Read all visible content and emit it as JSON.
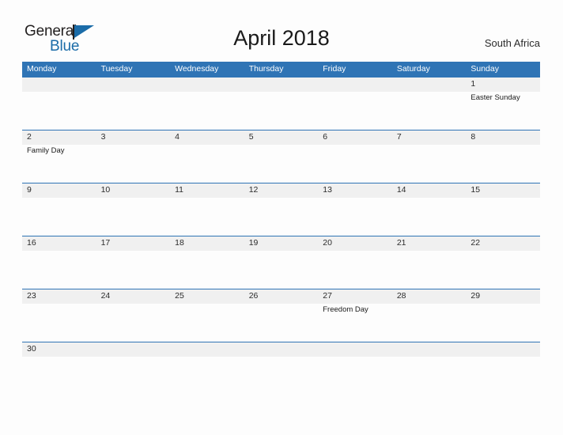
{
  "brand": {
    "word_one": "General",
    "word_two": "Blue",
    "accent_color": "#1b6ca8"
  },
  "header": {
    "title": "April 2018",
    "country": "South Africa",
    "header_bg": "#2F74B5",
    "band_bg": "#F0F0F0"
  },
  "weekday_headers": [
    "Monday",
    "Tuesday",
    "Wednesday",
    "Thursday",
    "Friday",
    "Saturday",
    "Sunday"
  ],
  "weeks": [
    {
      "days": [
        {
          "num": "",
          "event": ""
        },
        {
          "num": "",
          "event": ""
        },
        {
          "num": "",
          "event": ""
        },
        {
          "num": "",
          "event": ""
        },
        {
          "num": "",
          "event": ""
        },
        {
          "num": "",
          "event": ""
        },
        {
          "num": "1",
          "event": "Easter Sunday"
        }
      ]
    },
    {
      "days": [
        {
          "num": "2",
          "event": "Family Day"
        },
        {
          "num": "3",
          "event": ""
        },
        {
          "num": "4",
          "event": ""
        },
        {
          "num": "5",
          "event": ""
        },
        {
          "num": "6",
          "event": ""
        },
        {
          "num": "7",
          "event": ""
        },
        {
          "num": "8",
          "event": ""
        }
      ]
    },
    {
      "days": [
        {
          "num": "9",
          "event": ""
        },
        {
          "num": "10",
          "event": ""
        },
        {
          "num": "11",
          "event": ""
        },
        {
          "num": "12",
          "event": ""
        },
        {
          "num": "13",
          "event": ""
        },
        {
          "num": "14",
          "event": ""
        },
        {
          "num": "15",
          "event": ""
        }
      ]
    },
    {
      "days": [
        {
          "num": "16",
          "event": ""
        },
        {
          "num": "17",
          "event": ""
        },
        {
          "num": "18",
          "event": ""
        },
        {
          "num": "19",
          "event": ""
        },
        {
          "num": "20",
          "event": ""
        },
        {
          "num": "21",
          "event": ""
        },
        {
          "num": "22",
          "event": ""
        }
      ]
    },
    {
      "days": [
        {
          "num": "23",
          "event": ""
        },
        {
          "num": "24",
          "event": ""
        },
        {
          "num": "25",
          "event": ""
        },
        {
          "num": "26",
          "event": ""
        },
        {
          "num": "27",
          "event": "Freedom Day"
        },
        {
          "num": "28",
          "event": ""
        },
        {
          "num": "29",
          "event": ""
        }
      ]
    },
    {
      "days": [
        {
          "num": "30",
          "event": ""
        },
        {
          "num": "",
          "event": ""
        },
        {
          "num": "",
          "event": ""
        },
        {
          "num": "",
          "event": ""
        },
        {
          "num": "",
          "event": ""
        },
        {
          "num": "",
          "event": ""
        },
        {
          "num": "",
          "event": ""
        }
      ]
    }
  ]
}
